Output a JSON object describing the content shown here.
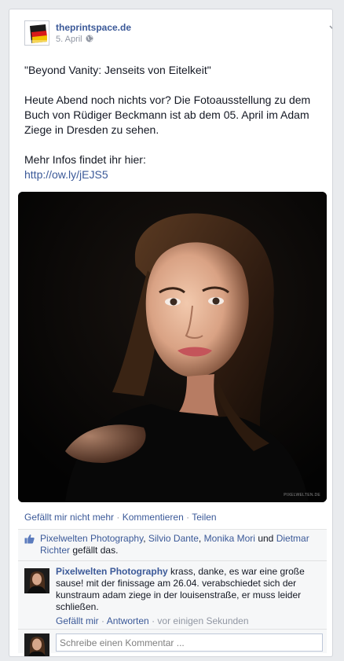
{
  "post": {
    "author": "theprintspace.de",
    "date": "5. April",
    "audience_icon": "globe-icon",
    "text": {
      "title": "\"Beyond Vanity: Jenseits von Eitelkeit\"",
      "line1": "Heute Abend noch nichts vor? Die Fotoausstellung zu dem",
      "line2": "Buch von Rüdiger Beckmann ist ab dem 05. April im Adam",
      "line3": "Ziege in Dresden zu sehen.",
      "more": "Mehr Infos findet ihr hier:",
      "link": "http://ow.ly/jEJS5"
    },
    "photo_watermark": "PIXELWELTEN.DE"
  },
  "actions": {
    "unlike": "Gefällt mir nicht mehr",
    "comment": "Kommentieren",
    "share": "Teilen",
    "separator": "·"
  },
  "likes": {
    "icon": "like-thumb-icon",
    "names": [
      "Pixelwelten Photography",
      "Silvio Dante",
      "Monika Mori",
      "Dietmar Richter"
    ],
    "comma": ",",
    "and": "und",
    "suffix": "gefällt das."
  },
  "comment": {
    "author": "Pixelwelten Photography",
    "text": "krass, danke, es war eine große sause! mit der finissage am 26.04. verabschiedet sich der kunstraum adam ziege in der louisenstraße, er muss leider schließen.",
    "like": "Gefällt mir",
    "reply": "Antworten",
    "time": "vor einigen Sekunden"
  },
  "composer": {
    "placeholder": "Schreibe einen Kommentar ..."
  },
  "colors": {
    "link": "#3b5998",
    "text": "#141823",
    "muted": "#9197a3",
    "feedback_bg": "#f6f7f8",
    "page_bg": "#e9ebee"
  }
}
